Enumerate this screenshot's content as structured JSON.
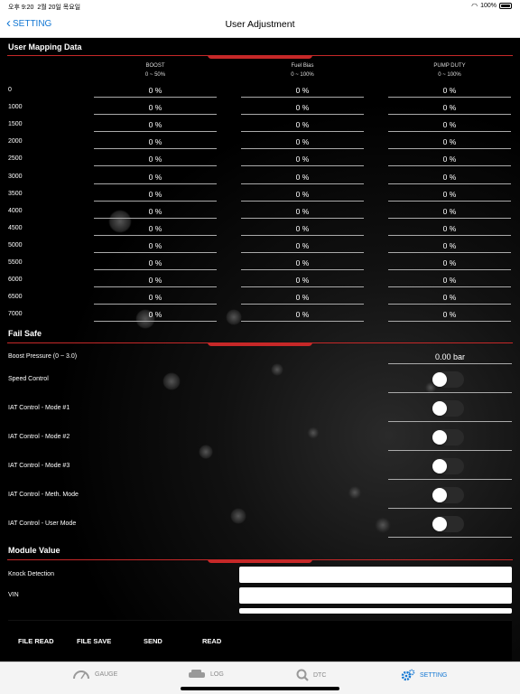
{
  "status": {
    "time": "오후 9:20",
    "date": "2월 20일 목요일",
    "battery": "100%"
  },
  "nav": {
    "back_label": "SETTING",
    "title": "User Adjustment"
  },
  "mapping": {
    "title": "User Mapping Data",
    "columns": [
      {
        "name": "BOOST",
        "range": "0 ~ 50%"
      },
      {
        "name": "Fuel Bias",
        "range": "0 ~ 100%"
      },
      {
        "name": "PUMP DUTY",
        "range": "0 ~ 100%"
      }
    ],
    "rows": [
      {
        "rpm": "0",
        "values": [
          "0 %",
          "0 %",
          "0 %"
        ]
      },
      {
        "rpm": "1000",
        "values": [
          "0 %",
          "0 %",
          "0 %"
        ]
      },
      {
        "rpm": "1500",
        "values": [
          "0 %",
          "0 %",
          "0 %"
        ]
      },
      {
        "rpm": "2000",
        "values": [
          "0 %",
          "0 %",
          "0 %"
        ]
      },
      {
        "rpm": "2500",
        "values": [
          "0 %",
          "0 %",
          "0 %"
        ]
      },
      {
        "rpm": "3000",
        "values": [
          "0 %",
          "0 %",
          "0 %"
        ]
      },
      {
        "rpm": "3500",
        "values": [
          "0 %",
          "0 %",
          "0 %"
        ]
      },
      {
        "rpm": "4000",
        "values": [
          "0 %",
          "0 %",
          "0 %"
        ]
      },
      {
        "rpm": "4500",
        "values": [
          "0 %",
          "0 %",
          "0 %"
        ]
      },
      {
        "rpm": "5000",
        "values": [
          "0 %",
          "0 %",
          "0 %"
        ]
      },
      {
        "rpm": "5500",
        "values": [
          "0 %",
          "0 %",
          "0 %"
        ]
      },
      {
        "rpm": "6000",
        "values": [
          "0 %",
          "0 %",
          "0 %"
        ]
      },
      {
        "rpm": "6500",
        "values": [
          "0 %",
          "0 %",
          "0 %"
        ]
      },
      {
        "rpm": "7000",
        "values": [
          "0 %",
          "0 %",
          "0 %"
        ]
      }
    ]
  },
  "failsafe": {
    "title": "Fail Safe",
    "boost_label": "Boost Pressure (0 ~ 3.0)",
    "boost_value": "0.00 bar",
    "toggles": [
      {
        "label": "Speed Control",
        "on": false
      },
      {
        "label": "IAT Control - Mode #1",
        "on": false
      },
      {
        "label": "IAT Control - Mode #2",
        "on": false
      },
      {
        "label": "IAT Control - Mode #3",
        "on": false
      },
      {
        "label": "IAT Control - Meth. Mode",
        "on": false
      },
      {
        "label": "IAT Control - User Mode",
        "on": false
      }
    ]
  },
  "module": {
    "title": "Module Value",
    "fields": [
      {
        "label": "Knock Detection",
        "value": ""
      },
      {
        "label": "VIN",
        "value": ""
      }
    ]
  },
  "actions": [
    "FILE READ",
    "FILE SAVE",
    "SEND",
    "READ"
  ],
  "tabs": [
    {
      "label": "GAUGE",
      "icon": "gauge-icon"
    },
    {
      "label": "LOG",
      "icon": "car-icon"
    },
    {
      "label": "DTC",
      "icon": "search-icon"
    },
    {
      "label": "SETTING",
      "icon": "gear-icon",
      "active": true
    }
  ],
  "colors": {
    "accent": "#c62828",
    "link": "#1478d4"
  }
}
